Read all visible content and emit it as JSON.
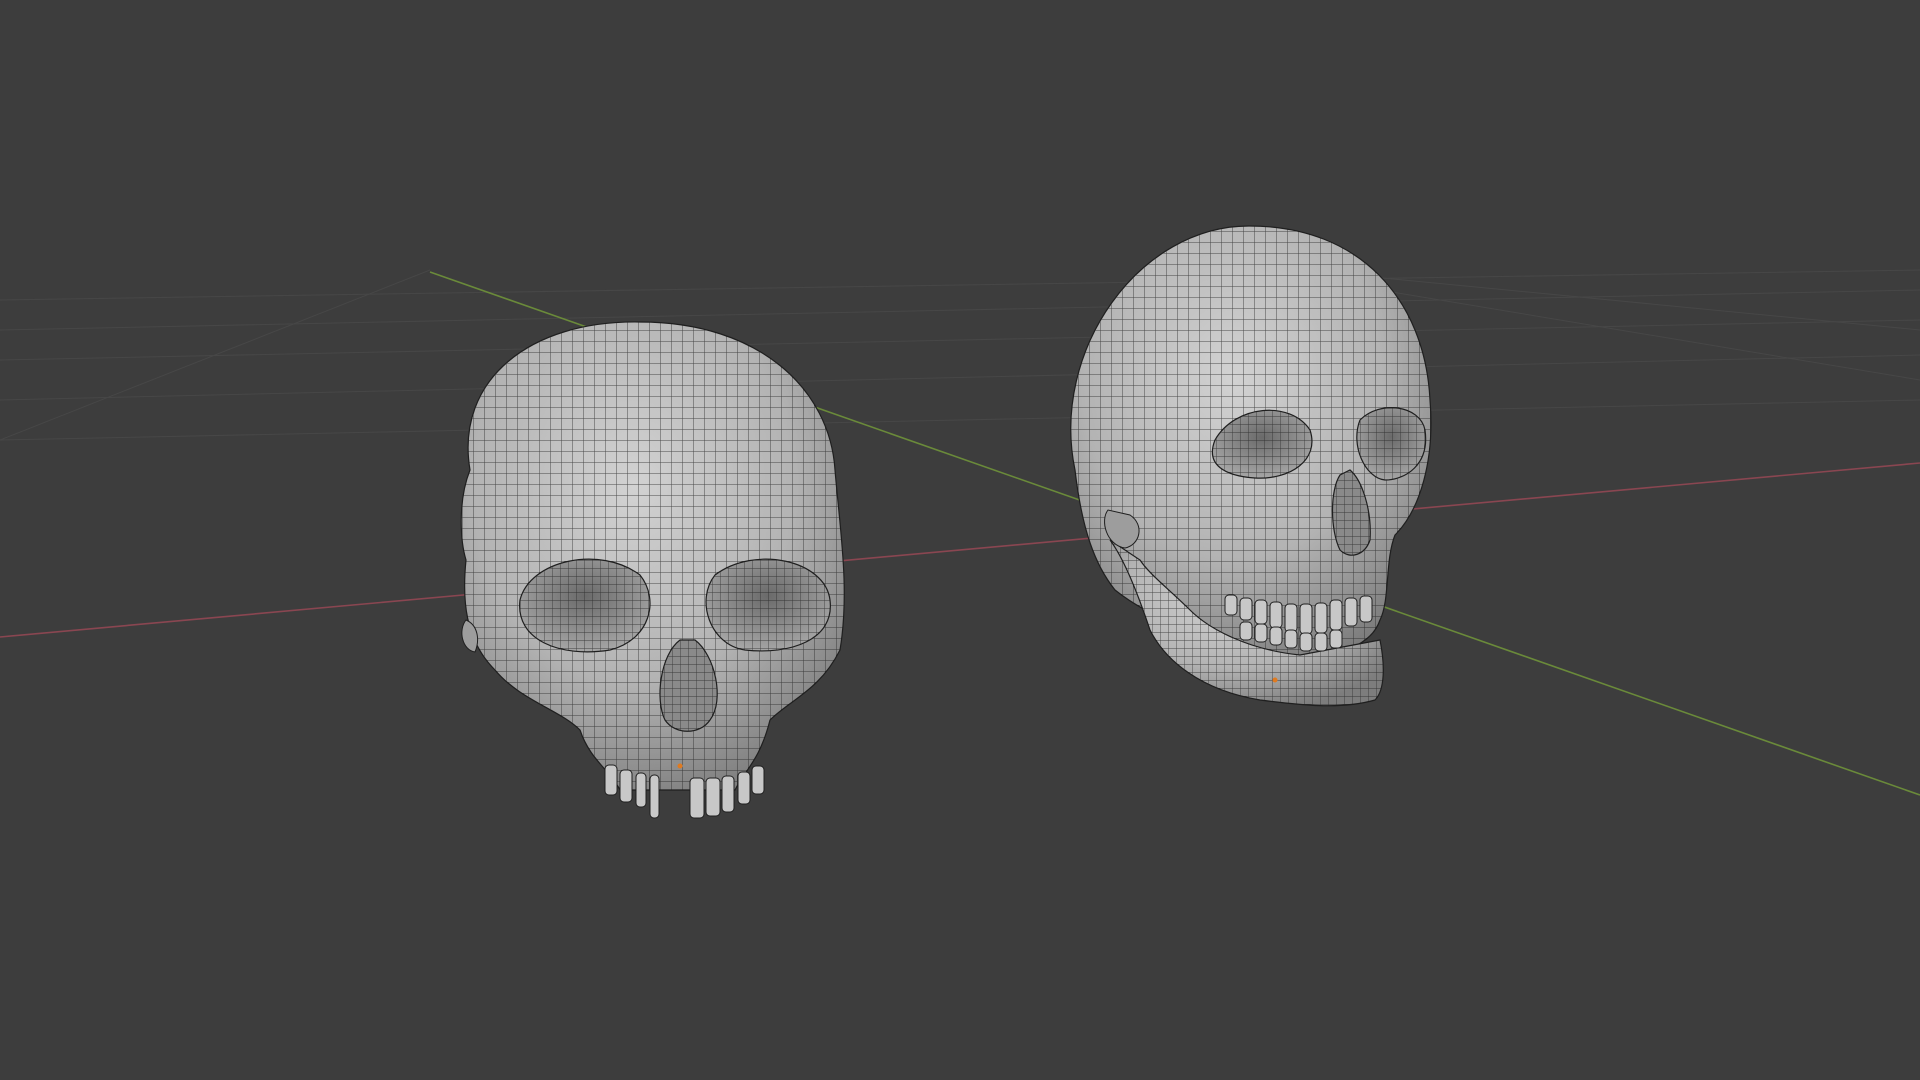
{
  "viewport": {
    "background": "#3d3d3d",
    "grid_color": "#474747",
    "x_axis_color": "#8a4651",
    "y_axis_color": "#6a8a3a",
    "mesh_fill": "#b9b9b9",
    "mesh_wire": "#1f1f1f",
    "origin_dot_color": "#e07a1f"
  },
  "objects": [
    {
      "name": "skull-front",
      "type": "mesh",
      "wireframe_overlay": true,
      "has_jaw": false
    },
    {
      "name": "skull-three-quarter",
      "type": "mesh",
      "wireframe_overlay": true,
      "has_jaw": true
    }
  ]
}
